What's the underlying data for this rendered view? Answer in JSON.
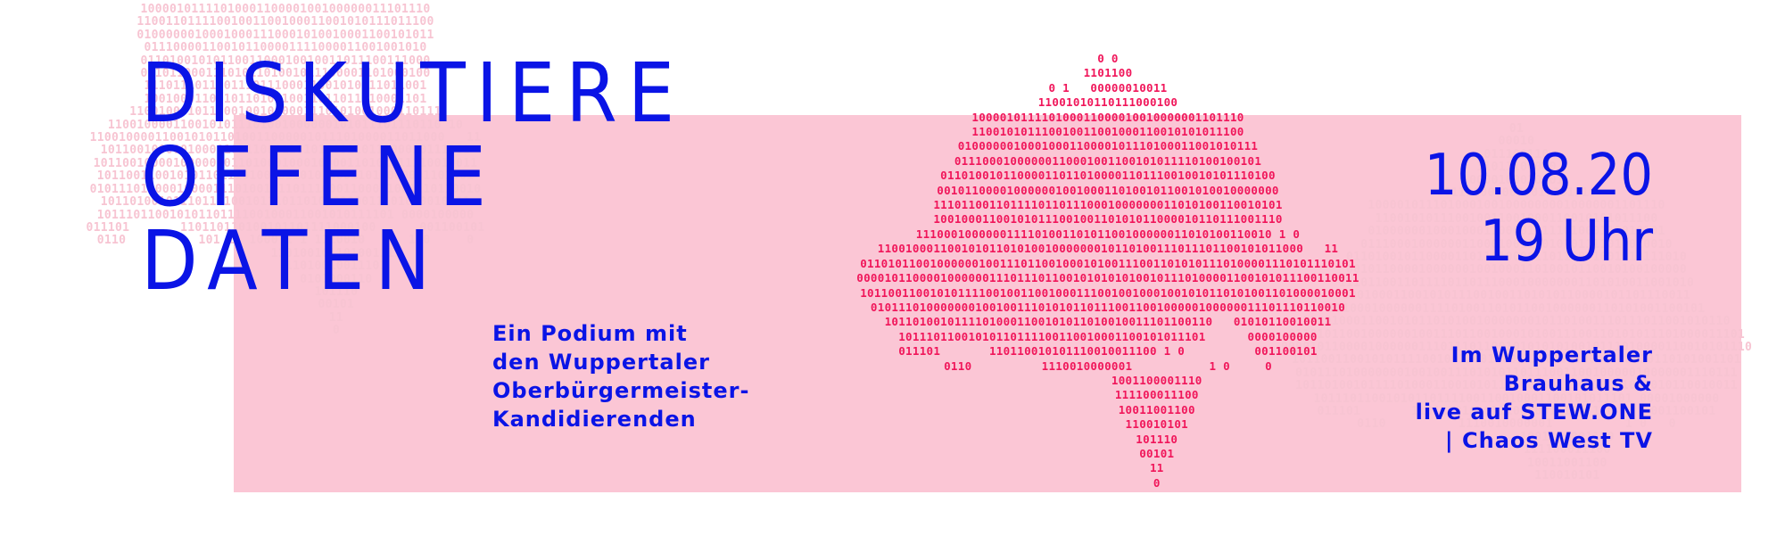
{
  "colors": {
    "accent_blue": "#0a14e6",
    "panel_pink": "#fbc6d5",
    "binary_pink": "#f0165a",
    "binary_light": "#ff8faf"
  },
  "headline": {
    "line1": "DISKUTIERE",
    "line2": "OFFENE",
    "line3": "DATEN"
  },
  "subline": {
    "line1": "Ein Podium mit",
    "line2": "den Wuppertaler",
    "line3": "Oberbürgermeister-",
    "line4": "Kandidierenden"
  },
  "event": {
    "date": "10.08.20",
    "time": "19 Uhr"
  },
  "venue": {
    "line1": "Im Wuppertaler",
    "line2": "Brauhaus &",
    "line3": "live auf STEW.ONE",
    "line4": "| Chaos West TV"
  },
  "binary_maps": {
    "left": "1000010111101000110000100100000011101110\n11001101111001001100100011001010111011100\n01000000100010001110001010010001100101011\n011100001100101100001111000011001001010\n0110100101011001100010010011011100111000\n0010110001110101101001011100001101000100\n111011101110111011100011001010111011001\n100100011001011010010011011011110001101\n1100100010110001001000001110101001000110111\n1100100001100101011101001000000101011101110110 10\n1100100001100101011010011000001011101000011011000   11\n101100100000100001011100011010100011011100010111101\n10110010000100000101101000100010000110101011110010011\n1011001100101011011101001011010100011011000001101001\n010111010000100001110100101101110001100011001110110010\n101101001011101101001011101101000000011101010010011\n10111011001010110111100100011001010111101 0000100000\n011101       110110110100101101111000100      001100101\n0110          101 11 1000 1 1 1110010      1 0     0\n              110100101101001111\n              11010010011101\n              0101000110\n              101110\n              00101\n              11\n              0",
    "center": "0 0\n1101100\n0 1   00000010011\n11001010110111000100\n100001011110100011000010010000001101110\n110010101110010011001000110010101011100\n0100000010001000110000101110100011001010111\n01110001000000110001001100101011110100100101\n011010010110000110110100001101110010010101110100\n0010110000100000010010001101001011001010010000000\n11101100110111101101110001000000011010100110010101\n10010001100101011100100110101011000010110111001110\n111000100000011110100110101100100000011010100110010 1 0\n1100100011001010110101001000000010110100111011101100101011000   11\n01101011001000000100111011001000101001110011010101110100001110101110101\n000010110000100000011101110110010101010100101110100001100101011100110011\n10110011001010111100100110010001110010010001001010110101001101000010001\n01011101000000010010011101010110111001100100000100000011101110110010\n10110100101111010001100101011010010011101100110   01010110010011\n10111011001010110111100110010001100101011101      0000100000\n011101       110110010101110010011100 1 0          001100101\n0110          1110010000001           1 0     0\n              1001100001110\n              111100011100\n              10011001100\n              110010101\n              101110\n              00101\n              11\n              0",
    "right": "01\n00010\n011100110\n11011100000\n0000100010001\n0011110000000011101110\n10000101110100010010000000010000001101110\n110010101110010011001000110010101011100\n01000000100010001100001011101000110010101\n0111000100000011000100110010101111010010010\n01101001011000011011010000110111001001010111010\n00101100001000000100100011010010110010100100000\n1110110011011110110111000100000001101010011001010\n100100011001010111001001101010110000101101110011\n1110001000000111101001101011001000000110101001100101\n11001000110010101101010010000000101101001110111011001010110\n011010110010000001001110110010001010011100110101011101000011101\n00001011000010000001110111011001010101010010111010000110010101110\n10110011001010111100100110010001110010010001001010110101001101\n0101110100000001001001110101011011100110010000010000001110111\n1011010010111101000110010101101001001110110011001010110010011\n10111011001010110111100110010001100101011101 00001000000\n011101       110110010101110010011100 1 0     001100101\n0110          1110010000001          1 0   0\n              1001100001110\n              111100011100\n              10011001100\n              110010101"
  }
}
